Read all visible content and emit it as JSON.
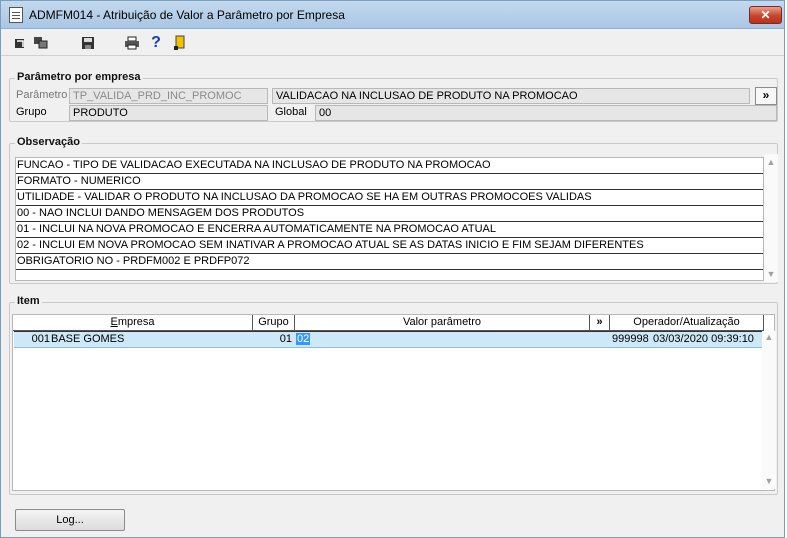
{
  "window": {
    "title": "ADMFM014 - Atribuição de Valor a Parâmetro por Empresa",
    "close_label": "✕"
  },
  "toolbar": {
    "icons": [
      "arrow-icon",
      "windows-icon",
      "save-icon",
      "print-icon",
      "help-icon",
      "exit-icon"
    ],
    "help_label": "?"
  },
  "parametro_section": {
    "legend": "Parâmetro por empresa",
    "parametro_label": "Parâmetro",
    "parametro_code": "TP_VALIDA_PRD_INC_PROMOC",
    "parametro_desc": "VALIDACAO NA INCLUSAO DE PRODUTO NA PROMOCAO",
    "expand_label": "»",
    "grupo_label": "Grupo",
    "grupo_value": "PRODUTO",
    "global_label": "Global",
    "global_value": "00"
  },
  "observacao_section": {
    "legend": "Observação",
    "lines": [
      "FUNCAO - TIPO DE VALIDACAO EXECUTADA NA INCLUSAO DE PRODUTO NA PROMOCAO",
      "FORMATO - NUMERICO",
      "UTILIDADE - VALIDAR O PRODUTO NA INCLUSAO DA PROMOCAO SE HA EM OUTRAS PROMOCOES VALIDAS",
      "00 - NAO INCLUI DANDO MENSAGEM DOS PRODUTOS",
      "01 - INCLUI NA NOVA PROMOCAO E ENCERRA AUTOMATICAMENTE NA PROMOCAO ATUAL",
      "02 - INCLUI EM NOVA PROMOCAO SEM INATIVAR A PROMOCAO ATUAL SE AS DATAS INICIO E FIM SEJAM DIFERENTES",
      "OBRIGATORIO NO - PRDFM002 E PRDFP072"
    ]
  },
  "item_section": {
    "legend": "Item",
    "columns": {
      "empresa_first": "E",
      "empresa_rest": "mpresa",
      "grupo": "Grupo",
      "valor": "Valor parâmetro",
      "expand": "»",
      "operador": "Operador/Atualização"
    },
    "rows": [
      {
        "empresa_code": "001",
        "empresa_name": "BASE GOMES",
        "grupo": "01",
        "valor": "02",
        "operador": "999998",
        "atualizacao": "03/03/2020 09:39:10"
      }
    ]
  },
  "footer": {
    "log_label": "Log..."
  }
}
